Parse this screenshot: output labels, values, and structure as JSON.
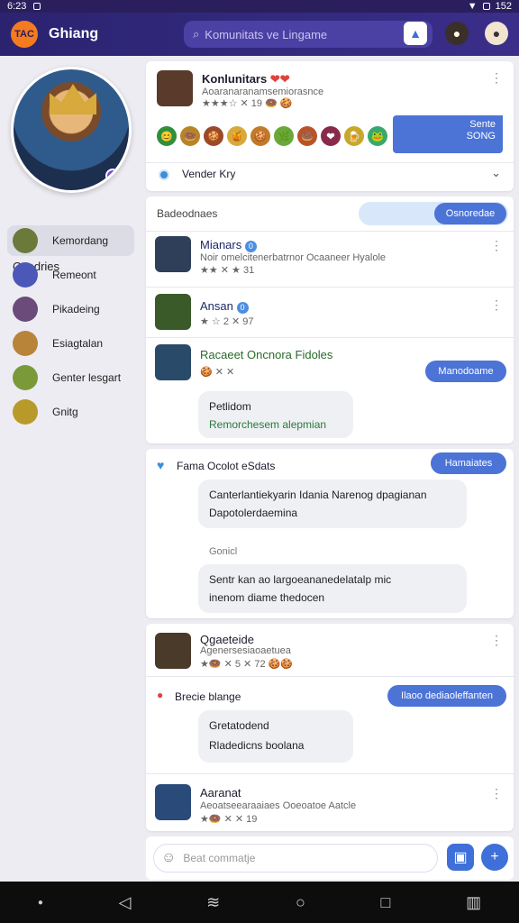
{
  "status": {
    "time": "6:23",
    "battery": "152"
  },
  "header": {
    "logo_text": "TAC",
    "app_title": "Ghiang",
    "search_placeholder": "Komunitats ve Lingame",
    "search_icon": "search-icon",
    "icons": [
      "gallery-icon",
      "hero-avatar",
      "user-avatar"
    ]
  },
  "sidebar": {
    "heading": "Coedries",
    "items": [
      {
        "label": "Kemordang",
        "color": "#6b7a3a"
      },
      {
        "label": "Remeont",
        "color": "#4b58b8"
      },
      {
        "label": "Pikadeing",
        "color": "#6a4b7a"
      },
      {
        "label": "Esiagtalan",
        "color": "#b8843a"
      },
      {
        "label": "Genter lesgart",
        "color": "#7a9a3a"
      },
      {
        "label": "Gnitg",
        "color": "#b89a2a"
      }
    ]
  },
  "community": {
    "name": "Konlunitars",
    "hearts": "❤❤",
    "subtitle": "Aoaranaranamsemiorasnce",
    "stats": "★★★☆ ✕ 19 🍩 🍪",
    "emojis": [
      "😊",
      "🍩",
      "🍪",
      "🍯",
      "🍪",
      "🌿",
      "🍩",
      "❤",
      "🍺",
      "🐸"
    ],
    "side_button": "Sente\nSONG",
    "selector_label": "Vender Kry"
  },
  "posts_header": {
    "label": "Badeodnaes",
    "button": "Osnoredae"
  },
  "threads": [
    {
      "name": "Mianars",
      "badge": "0",
      "line": "Noir omelcitenerbatrnor Ocaaneer Hyalole",
      "stats": "★★ ✕ ★ 31"
    },
    {
      "name": "Ansan",
      "badge": "0",
      "line": "",
      "stats": "★ ☆ 2 ✕ 97"
    },
    {
      "name": "Racaeet Oncnora Fidoles",
      "badge": "",
      "line": "",
      "stats": "🍪 ✕ ✕",
      "button": "Manodoame",
      "bubble_line1": "Petlidom",
      "bubble_line2": "Remorchesem alepmian"
    }
  ],
  "feed": {
    "title": "Fama Ocolot eSdats",
    "button": "Hamaiates",
    "bubble1_line1": "Canterlantiekyarin Idania  Narenog dpagianan",
    "bubble1_line2": "Dapotolerdaemina",
    "reply_author": "Gonicl",
    "bubble2_line1": "Sentr kan ao largoeananedelatalp mic",
    "bubble2_line2": "inenom diame thedocen"
  },
  "post2": {
    "name": "Qgaeteide",
    "subtitle": "Agenersesiaoaetuea",
    "stats": "★🍩 ✕ 5 ✕ 72 🍪🍪"
  },
  "post3": {
    "title": "Brecie blange",
    "button": "Ilaoo dediaoleffanten",
    "bubble_line1": "Gretatodend",
    "bubble_line2": "Rladedicns boolana"
  },
  "post4": {
    "name": "Aaranat",
    "subtitle": "Aeoatseearaaiaes Ooeoatoe Aatcle",
    "stats": "★🍩 ✕ ✕ 19"
  },
  "composer": {
    "placeholder": "Beat commatje"
  },
  "colors": {
    "accent": "#4c73d6",
    "topbar": "#2b2370",
    "online": "#2fb86f"
  }
}
